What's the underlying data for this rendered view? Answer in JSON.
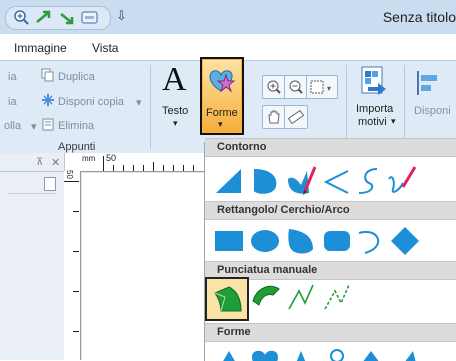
{
  "window": {
    "title": "Senza titolo"
  },
  "menu": {
    "tabs": [
      "Immagine",
      "Vista"
    ]
  },
  "ribbon": {
    "clipboard": {
      "partial_labels": [
        "ia",
        "ia",
        "olla"
      ],
      "items": [
        "Duplica",
        "Disponi copia",
        "Elimina"
      ],
      "group_label": "Appunti"
    },
    "text_button": "Testo",
    "shapes_button": "Forme",
    "import_button_line1": "Importa",
    "import_button_line2": "motivi",
    "arrange_partial": "Disponi"
  },
  "ruler": {
    "unit": "mm",
    "mark": "50",
    "left_mark": "50"
  },
  "shapes_menu": {
    "categories": [
      "Contorno",
      "Rettangolo/ Cerchio/Arco",
      "Punciatua manuale",
      "Forme"
    ]
  },
  "colors": {
    "accent_blue": "#1d8fd6",
    "shape_green": "#1f9d37",
    "highlight_orange": "#f7b23a",
    "selected_frame": "#222222"
  }
}
